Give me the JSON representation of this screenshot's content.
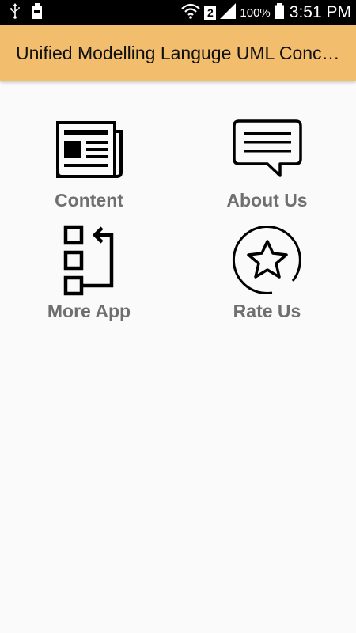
{
  "status_bar": {
    "sim_slot": "2",
    "battery_percent": "100%",
    "time": "3:51 PM",
    "icons": [
      "usb-icon",
      "battery-saver-icon",
      "wifi-icon",
      "signal-icon",
      "battery-icon"
    ]
  },
  "app_bar": {
    "title": "Unified Modelling Languge UML Concepts",
    "color": "#f3bd6e"
  },
  "menu": {
    "items": [
      {
        "label": "Content",
        "icon": "newspaper-icon"
      },
      {
        "label": "About Us",
        "icon": "chat-bubble-icon"
      },
      {
        "label": "More App",
        "icon": "app-list-icon"
      },
      {
        "label": "Rate Us",
        "icon": "star-rating-icon"
      }
    ],
    "label_color": "#6f6f6f"
  }
}
